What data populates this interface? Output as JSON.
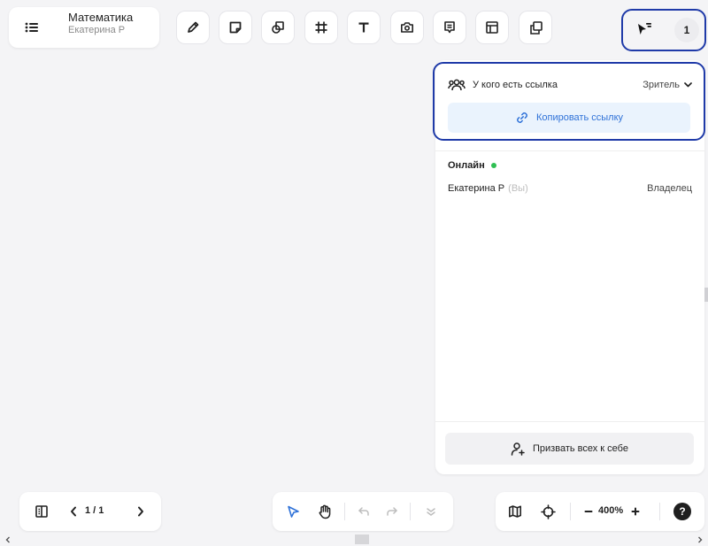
{
  "document": {
    "title": "Математика",
    "owner": "Екатерина Р"
  },
  "toolbar": {
    "tools": [
      "pencil-icon",
      "sticky-note-icon",
      "shapes-icon",
      "frame-icon",
      "text-icon",
      "camera-icon",
      "comment-icon",
      "table-icon",
      "duplicate-icon"
    ]
  },
  "header": {
    "participants_count": "1"
  },
  "share_panel": {
    "access_label": "У кого есть ссылка",
    "access_role": "Зритель",
    "copy_link_label": "Копировать ссылку",
    "online_heading": "Онлайн",
    "members": [
      {
        "name": "Екатерина Р",
        "you_tag": "(Вы)",
        "role": "Владелец"
      }
    ],
    "summon_label": "Призвать всех к себе"
  },
  "bottom_bar": {
    "page_counter": "1 / 1",
    "zoom": "400%"
  },
  "colors": {
    "accent_blue": "#2f72d8",
    "copy_link_bg": "#eaf3fd",
    "online_green": "#2fbf53",
    "highlight": "#1f3aa8"
  }
}
